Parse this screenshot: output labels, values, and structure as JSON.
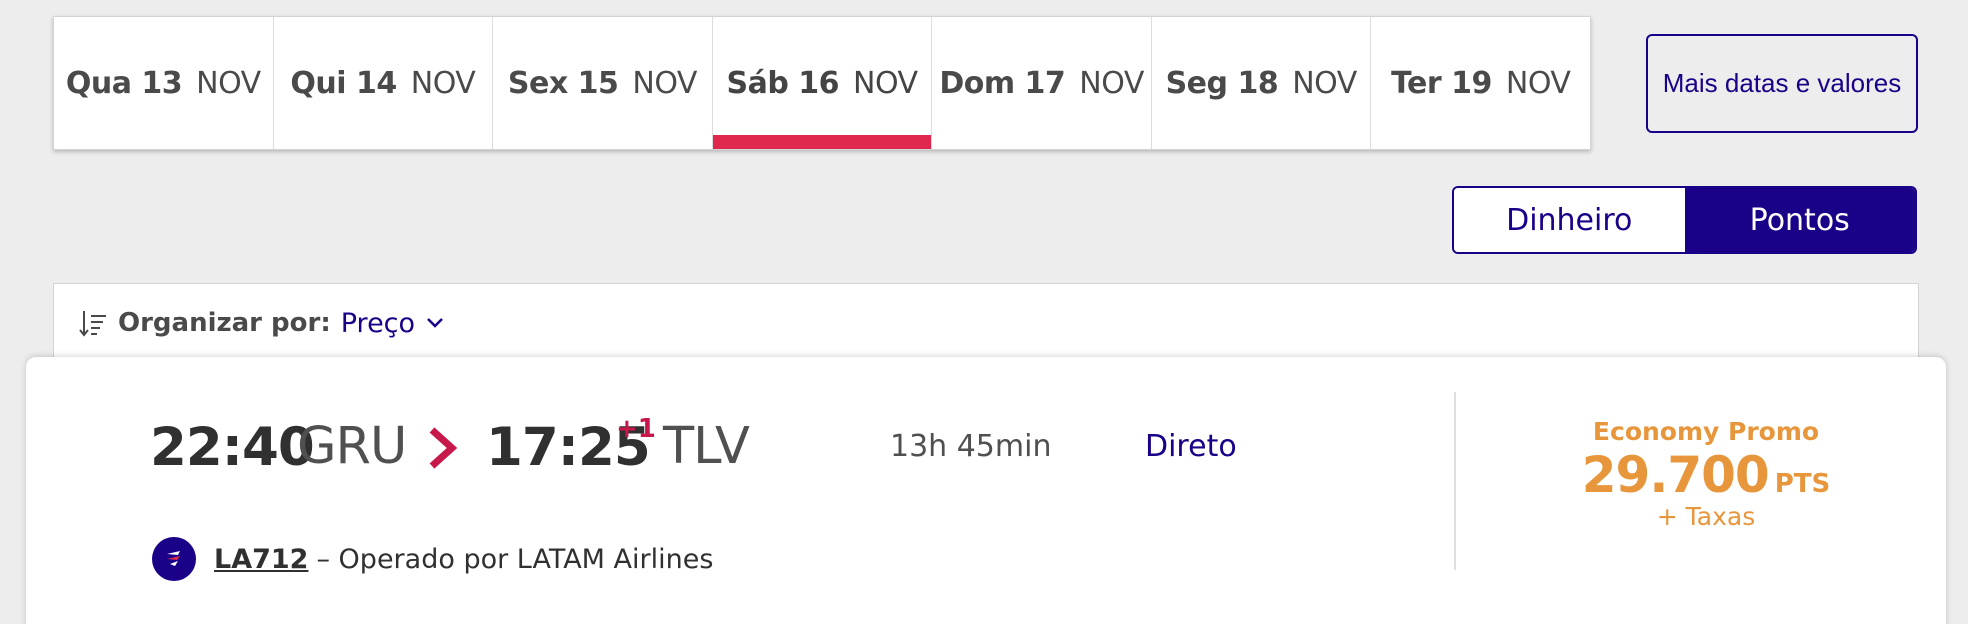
{
  "date_tabs": [
    {
      "day": "Qua 13",
      "month": "NOV"
    },
    {
      "day": "Qui 14",
      "month": "NOV"
    },
    {
      "day": "Sex 15",
      "month": "NOV"
    },
    {
      "day": "Sáb 16",
      "month": "NOV"
    },
    {
      "day": "Dom 17",
      "month": "NOV"
    },
    {
      "day": "Seg 18",
      "month": "NOV"
    },
    {
      "day": "Ter 19",
      "month": "NOV"
    }
  ],
  "more_dates_label": "Mais datas e valores",
  "currency_toggle": {
    "money": "Dinheiro",
    "points": "Pontos"
  },
  "sort": {
    "label": "Organizar por:",
    "value": "Preço"
  },
  "flight": {
    "departure_time": "22:40",
    "origin": "GRU",
    "arrival_time": "17:25",
    "day_offset": "+1",
    "destination": "TLV",
    "duration": "13h 45min",
    "stops": "Direto",
    "flight_number": "LA712",
    "operator": "– Operado por LATAM Airlines",
    "fare": {
      "cabin": "Economy Promo",
      "price": "29.700",
      "unit": "PTS",
      "taxes": "+ Taxas"
    }
  },
  "colors": {
    "brand_navy": "#1b0088",
    "active_underline": "#e0284f",
    "fare_orange": "#e8963c",
    "arrow_red": "#c8174b"
  },
  "icons": {
    "sort": "sort-lines-icon",
    "chevron": "chevron-down-icon",
    "arrow": "chevron-right-icon",
    "airline": "latam-logo-icon"
  }
}
